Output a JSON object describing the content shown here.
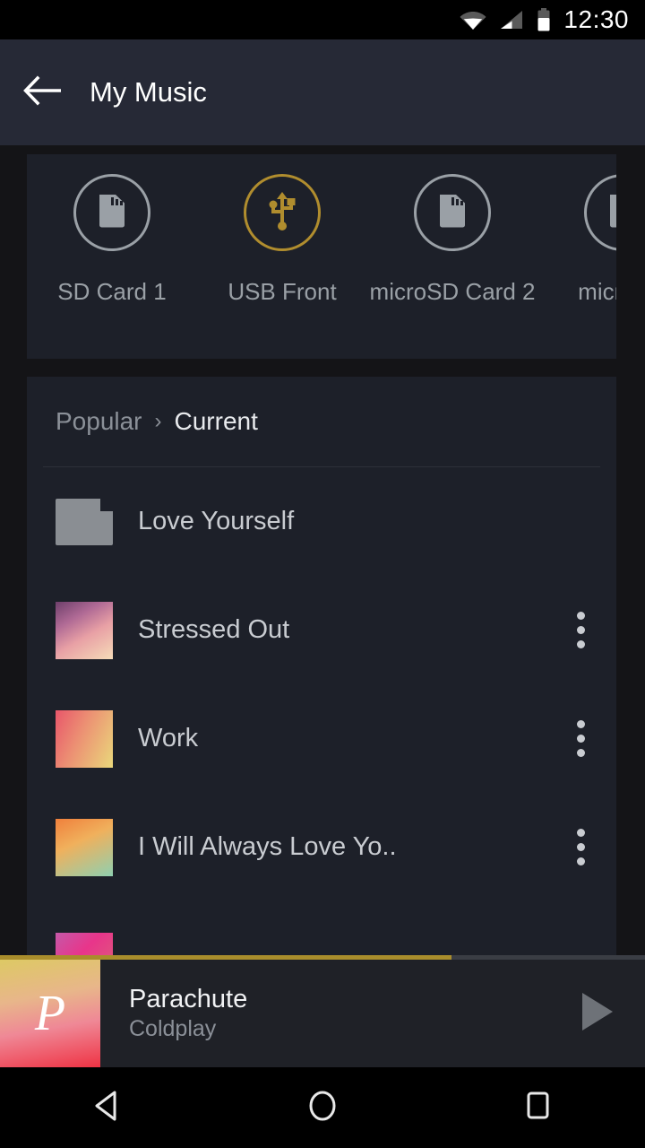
{
  "statusbar": {
    "time": "12:30",
    "icons": [
      "wifi-icon",
      "cellular-signal-icon",
      "battery-icon"
    ]
  },
  "appbar": {
    "back_icon": "back-arrow-icon",
    "title": "My Music"
  },
  "storage": {
    "items": [
      {
        "label": "SD Card 1",
        "icon": "sd-card-icon",
        "selected": false
      },
      {
        "label": "USB Front",
        "icon": "usb-icon",
        "selected": true
      },
      {
        "label": "microSD Card 2",
        "icon": "sd-card-icon",
        "selected": false
      },
      {
        "label": "microSD",
        "icon": "sd-card-icon",
        "selected": false
      }
    ],
    "selected_color": "#b08d2e",
    "inactive_color": "#9aa0a6"
  },
  "breadcrumb": {
    "parent": "Popular",
    "separator": "›",
    "current": "Current"
  },
  "list": {
    "rows": [
      {
        "title": "Love Yourself",
        "art": "folder-icon",
        "has_menu": false
      },
      {
        "title": "Stressed Out",
        "art": "album-art",
        "has_menu": true
      },
      {
        "title": "Work",
        "art": "album-art",
        "has_menu": true
      },
      {
        "title": "I Will Always Love Yo..",
        "art": "album-art",
        "has_menu": true
      }
    ],
    "menu_icon": "overflow-menu-icon"
  },
  "player": {
    "title": "Parachute",
    "artist": "Coldplay",
    "art_letter": "P",
    "progress_percent": 70,
    "progress_color": "#a98d2c",
    "play_icon": "play-icon"
  },
  "navbar": {
    "back": "nav-back-icon",
    "home": "nav-home-icon",
    "recents": "nav-recents-icon"
  }
}
